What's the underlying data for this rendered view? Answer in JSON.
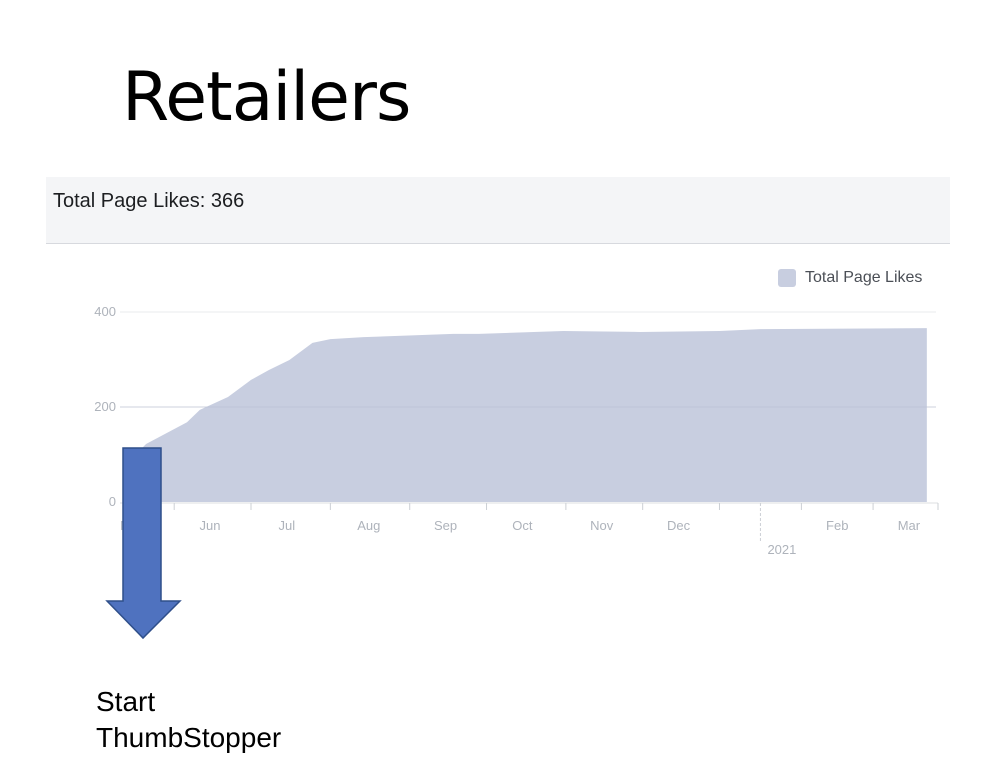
{
  "title": "Retailers",
  "card": {
    "header": "Total Page Likes: 366"
  },
  "annotation": {
    "line1": "Start",
    "line2": "ThumbStopper",
    "arrow_color": "#4f72bf"
  },
  "chart_data": {
    "type": "area",
    "title": "",
    "xlabel": "",
    "ylabel": "",
    "ylim": [
      0,
      400
    ],
    "yticks": [
      0,
      200,
      400
    ],
    "grid": true,
    "legend": {
      "position": "top-right",
      "entries": [
        "Total Page Likes"
      ]
    },
    "series": [
      {
        "name": "Total Page Likes",
        "color": "#c8cee0",
        "x": [
          "2020-05-12",
          "2020-05-21",
          "2020-06-06",
          "2020-06-11",
          "2020-06-22",
          "2020-07-01",
          "2020-07-08",
          "2020-07-16",
          "2020-07-25",
          "2020-08-01",
          "2020-08-14",
          "2020-09-18",
          "2020-09-28",
          "2020-10-31",
          "2020-11-30",
          "2020-12-31",
          "2021-01-16",
          "2021-03-22"
        ],
        "values": [
          72,
          122,
          168,
          194,
          221,
          257,
          278,
          299,
          335,
          343,
          347,
          354,
          354,
          360,
          358,
          360,
          364,
          366
        ]
      }
    ],
    "xtick_labels": [
      "M",
      "Jun",
      "Jul",
      "Aug",
      "Sep",
      "Oct",
      "Nov",
      "Dec",
      "Feb",
      "Mar"
    ],
    "year_marker": "2021"
  }
}
